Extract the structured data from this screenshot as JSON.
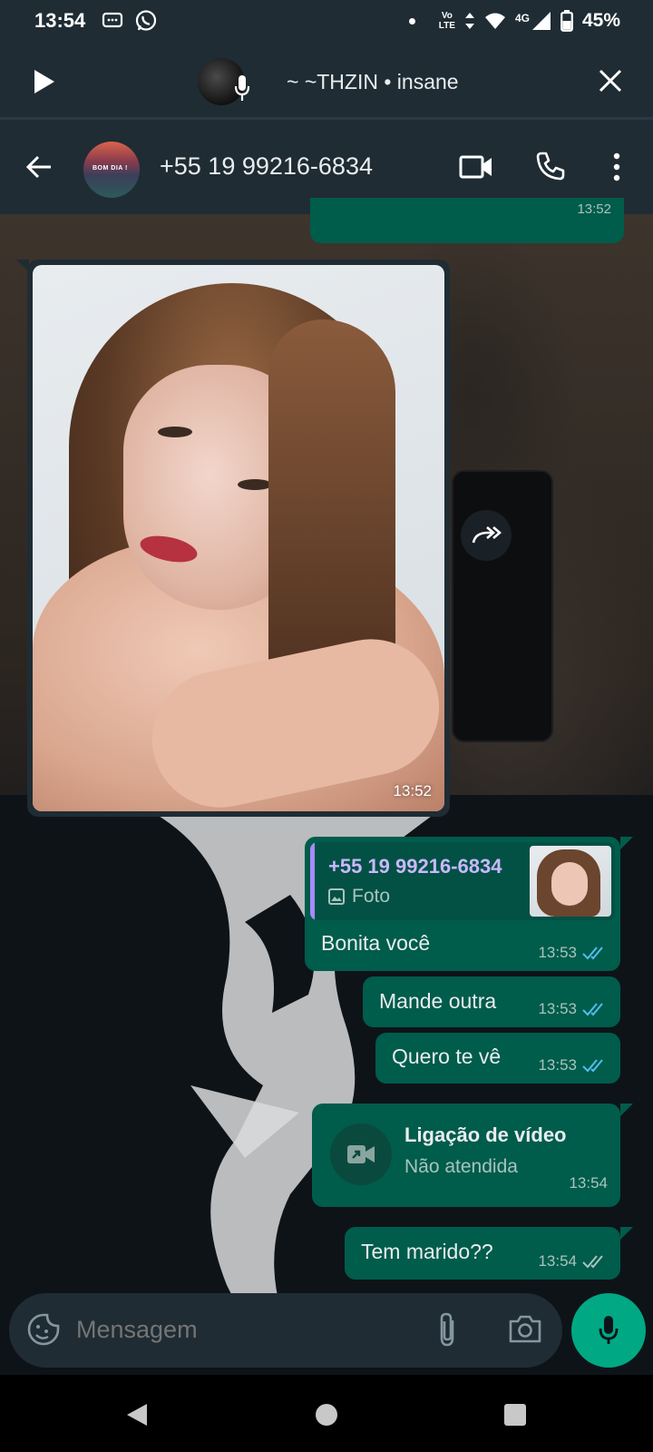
{
  "status_bar": {
    "time": "13:54",
    "network_line1": "Vo",
    "network_line2": "LTE",
    "signal_label": "4G",
    "battery": "45%"
  },
  "voice_chat": {
    "title": "~ ~THZIN • insane"
  },
  "header": {
    "contact_name": "+55 19 99216-6834",
    "avatar_caption": "BOM DIA !"
  },
  "messages": {
    "cut_time": "13:52",
    "image_time": "13:52",
    "reply": {
      "quoted_name": "+55 19 99216-6834",
      "quoted_type": "Foto",
      "text": "Bonita você",
      "time": "13:53"
    },
    "m2": {
      "text": "Mande outra",
      "time": "13:53"
    },
    "m3": {
      "text": "Quero te vê",
      "time": "13:53"
    },
    "call": {
      "title": "Ligação de vídeo",
      "subtitle": "Não atendida",
      "time": "13:54"
    },
    "m5": {
      "text": "Tem marido??",
      "time": "13:54"
    }
  },
  "input": {
    "placeholder": "Mensagem"
  },
  "colors": {
    "bubble_out": "#005c4b",
    "header_bg": "#1f2c34",
    "accent": "#00a884",
    "read_ticks": "#53bdeb"
  }
}
